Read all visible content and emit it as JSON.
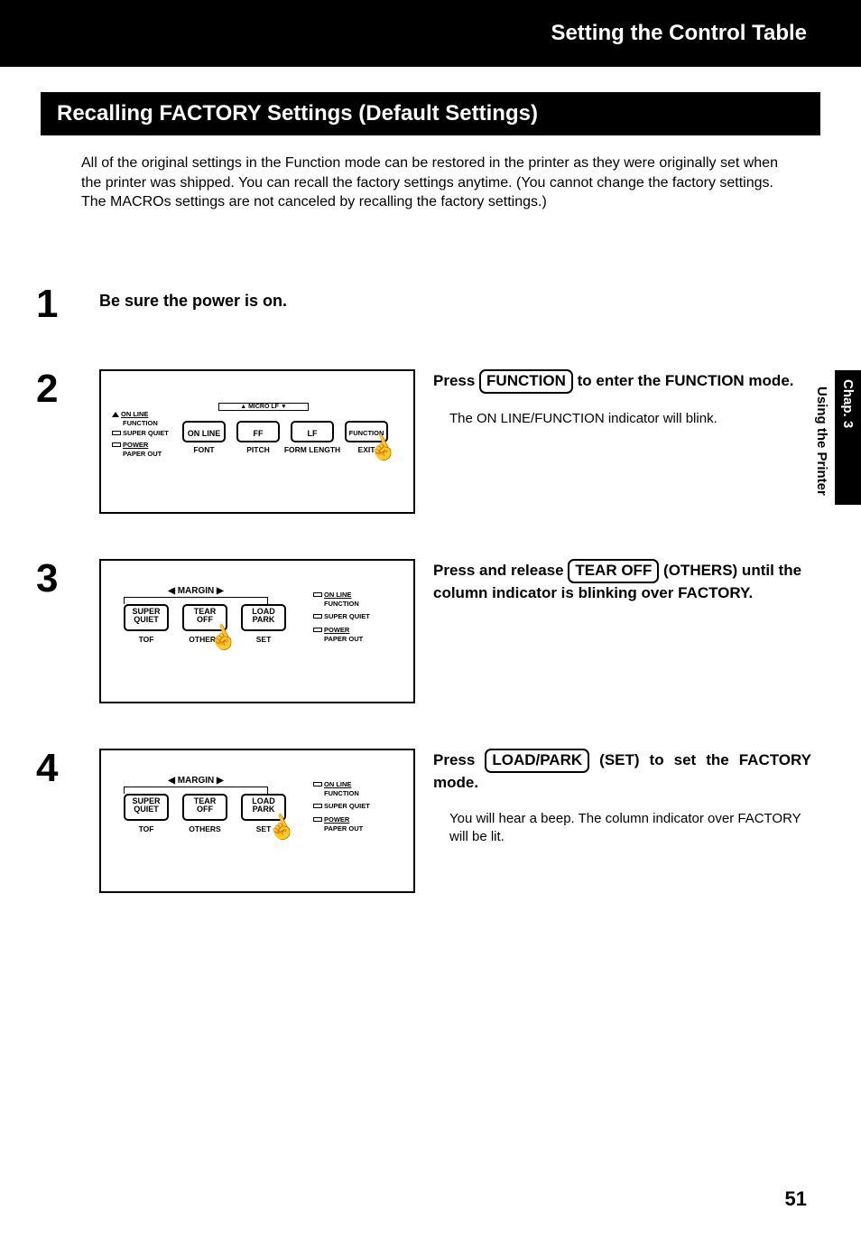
{
  "header": {
    "title": "Setting the Control Table"
  },
  "section": {
    "title": "Recalling FACTORY Settings (Default Settings)"
  },
  "intro": {
    "text": "All of the original settings in the Function mode can be restored in the printer as they were originally set when the printer was shipped. You can recall the factory settings anytime. (You cannot change the factory settings. The MACROs settings are not canceled by recalling the factory settings.)"
  },
  "steps": {
    "s1": {
      "num": "1",
      "text": "Be sure the power is on."
    },
    "s2": {
      "num": "2",
      "head_a": "Press ",
      "box": "FUNCTION",
      "head_b": " to enter the FUNCTION mode.",
      "sub": "The ON LINE/FUNCTION indicator will blink."
    },
    "s3": {
      "num": "3",
      "head_a": "Press and release ",
      "box": "TEAR OFF",
      "head_b": " (OTHERS) until the column indicator is blinking over FACTORY."
    },
    "s4": {
      "num": "4",
      "head_a": "Press ",
      "box": "LOAD/PARK",
      "head_b": " (SET) to set the FACTORY mode.",
      "sub": "You will hear a beep. The column indicator over FACTORY will be lit."
    }
  },
  "panel2": {
    "micro": "▲ MICRO LF ▼",
    "btns": {
      "b1": "ON LINE",
      "b2": "FF",
      "b3": "LF",
      "b4": "FUNCTION"
    },
    "subs": {
      "s1": "FONT",
      "s2": "PITCH",
      "s3": "FORM LENGTH",
      "s4": "EXIT"
    },
    "leds": {
      "l1": "ON LINE",
      "l1b": "FUNCTION",
      "l2": "SUPER QUIET",
      "l3": "POWER",
      "l3b": "PAPER OUT"
    }
  },
  "panel3": {
    "margin": "◀ MARGIN ▶",
    "btns": {
      "b1": "SUPER\nQUIET",
      "b2": "TEAR\nOFF",
      "b3": "LOAD\nPARK"
    },
    "subs": {
      "s1": "TOF",
      "s2": "OTHERS",
      "s3": "SET"
    },
    "leds": {
      "l1": "ON LINE",
      "l1b": "FUNCTION",
      "l2": "SUPER QUIET",
      "l3": "POWER",
      "l3b": "PAPER OUT"
    }
  },
  "panel4": {
    "margin": "◀ MARGIN ▶",
    "btns": {
      "b1": "SUPER\nQUIET",
      "b2": "TEAR\nOFF",
      "b3": "LOAD\nPARK"
    },
    "subs": {
      "s1": "TOF",
      "s2": "OTHERS",
      "s3": "SET"
    },
    "leds": {
      "l1": "ON LINE",
      "l1b": "FUNCTION",
      "l2": "SUPER QUIET",
      "l3": "POWER",
      "l3b": "PAPER OUT"
    }
  },
  "sidetab": {
    "chap": "Chap. 3",
    "sub": "Using the Printer"
  },
  "pagenum": "51"
}
